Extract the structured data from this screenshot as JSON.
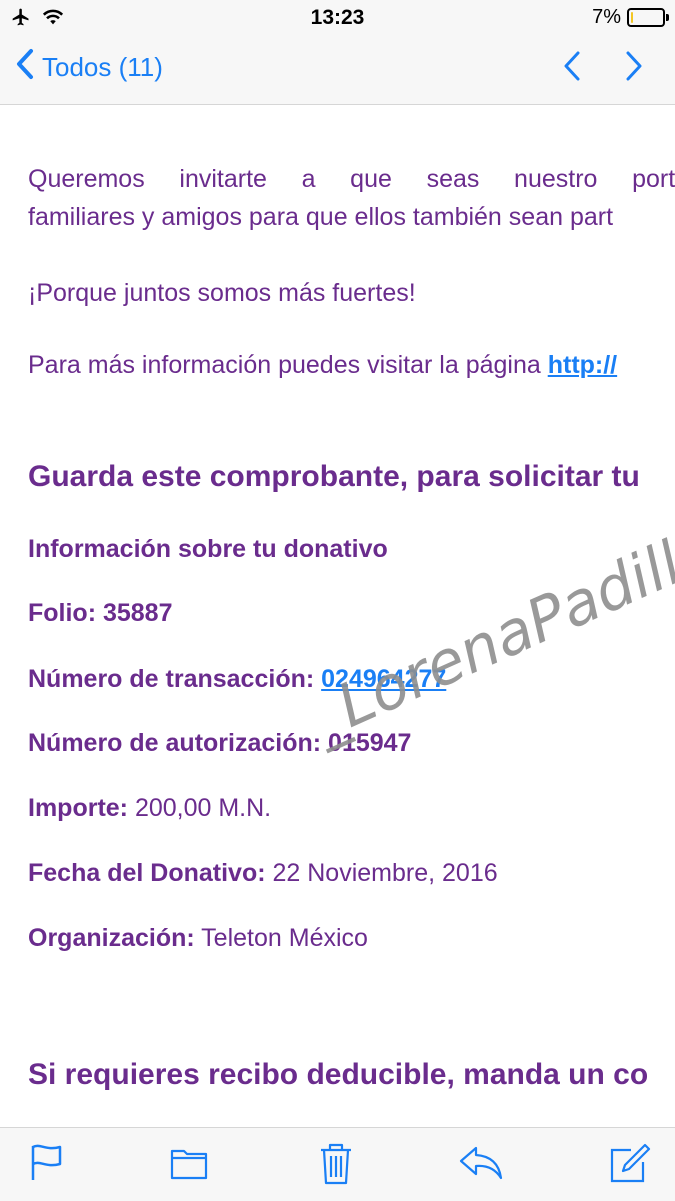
{
  "status_bar": {
    "time": "13:23",
    "battery_text": "7%",
    "battery_level": 0.07,
    "icons": [
      "airplane-icon",
      "wifi-icon",
      "battery-icon"
    ]
  },
  "nav": {
    "back_label": "Todos (11)",
    "accent_color": "#1a7ff5"
  },
  "email": {
    "text_color": "#6a2c8d",
    "para1_line1": "Queremos invitarte a que seas nuestro portavoz",
    "para1_line2": "familiares y amigos para que ellos también sean part",
    "para2": "¡Porque juntos somos más fuertes!",
    "para3_text": "Para más información puedes visitar la página ",
    "para3_link": "http://",
    "heading1": "Guarda este comprobante, para solicitar tu",
    "info_title": "Información sobre tu donativo",
    "folio": {
      "label": "Folio: 35887"
    },
    "transaccion": {
      "label": "Número de transacción: ",
      "value": "024964277"
    },
    "autorizacion": {
      "label": "Número de autorización: 015947"
    },
    "importe": {
      "label": "Importe:",
      "value": " 200,00 M.N."
    },
    "fecha": {
      "label": "Fecha del Donativo:",
      "value": " 22 Noviembre, 2016"
    },
    "organizacion": {
      "label": "Organización:",
      "value": " Teleton México"
    },
    "heading2": "Si requieres recibo deducible, manda un co"
  },
  "watermark": "_LorenaPadilla",
  "toolbar": {
    "icons": [
      "flag-icon",
      "folder-icon",
      "trash-icon",
      "reply-icon",
      "compose-icon"
    ]
  }
}
